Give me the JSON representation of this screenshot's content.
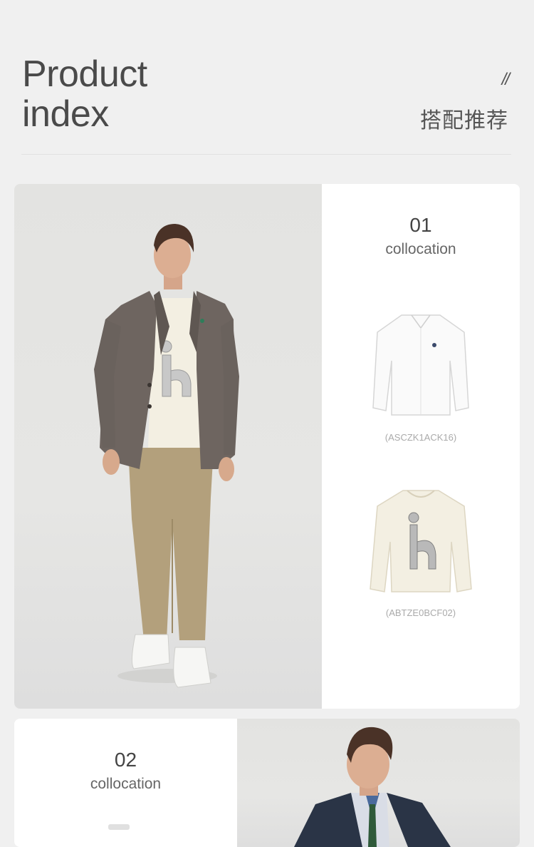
{
  "header": {
    "title_line1": "Product",
    "title_line2": "index",
    "slashes": "//",
    "subtitle_cn": "搭配推荐"
  },
  "collocations": [
    {
      "number": "01",
      "label": "collocation",
      "products": [
        {
          "sku": "(ASCZK1ACK16)",
          "type": "white-shirt-icon"
        },
        {
          "sku": "(ABTZE0BCF02)",
          "type": "cream-sweatshirt-icon"
        }
      ]
    },
    {
      "number": "02",
      "label": "collocation"
    }
  ],
  "colors": {
    "background": "#f0f0f0",
    "card": "#ffffff",
    "blazer": "#6e6560",
    "chinos": "#b3a07c",
    "sweatshirt": "#f3efe2",
    "navy_blazer": "#2a3446"
  }
}
